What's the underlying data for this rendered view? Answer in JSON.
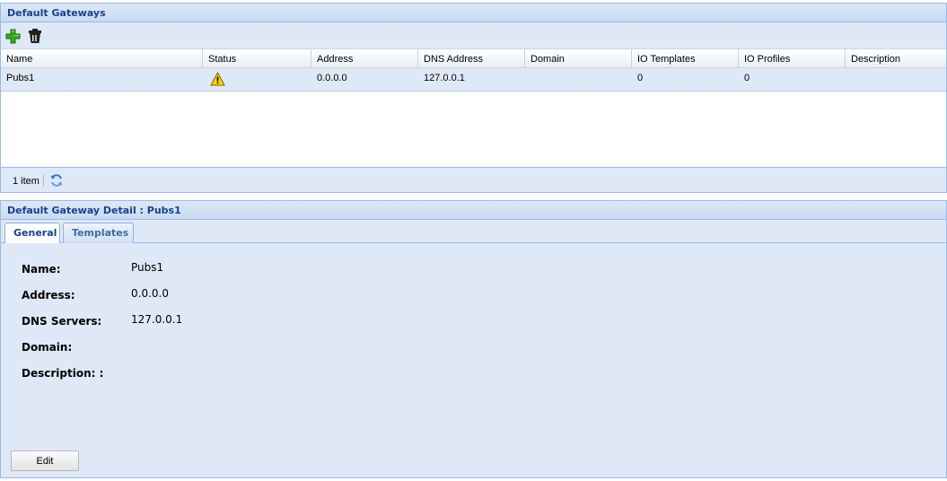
{
  "grid": {
    "title": "Default Gateways",
    "columns": [
      "Name",
      "Status",
      "Address",
      "DNS Address",
      "Domain",
      "IO Templates",
      "IO Profiles",
      "Description"
    ],
    "rows": [
      {
        "name": "Pubs1",
        "status": "warning-icon",
        "address": "0.0.0.0",
        "dns_address": "127.0.0.1",
        "domain": "",
        "io_templates": "0",
        "io_profiles": "0",
        "description": ""
      }
    ]
  },
  "toolbar": {
    "add_icon": "add-icon",
    "delete_icon": "trash-icon"
  },
  "paging": {
    "item_count": "1 item",
    "refresh_icon": "refresh-icon"
  },
  "detail": {
    "title": "Default Gateway Detail : Pubs1",
    "tabs": [
      "General",
      "Templates"
    ],
    "active_tab": "General",
    "fields": [
      {
        "label": "Name:",
        "value": "Pubs1"
      },
      {
        "label": "Address:",
        "value": "0.0.0.0"
      },
      {
        "label": "DNS Servers:",
        "value": "127.0.0.1"
      },
      {
        "label": "Domain:",
        "value": ""
      },
      {
        "label": "Description: :",
        "value": ""
      }
    ],
    "edit_label": "Edit"
  },
  "colors": {
    "header_text": "#15428b",
    "panel_bg": "#dfe8f6",
    "border": "#99bbe8",
    "warning": "#ffd400"
  }
}
